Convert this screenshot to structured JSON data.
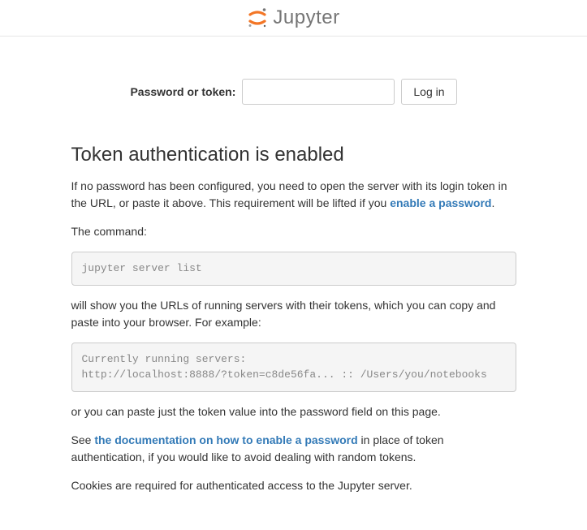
{
  "header": {
    "logo_text": "Jupyter"
  },
  "login": {
    "label": "Password or token:",
    "input_value": "",
    "button_label": "Log in"
  },
  "content": {
    "heading": "Token authentication is enabled",
    "p1_a": "If no password has been configured, you need to open the server with its login token in the URL, or paste it above. This requirement will be lifted if you ",
    "p1_link": "enable a password",
    "p1_b": ".",
    "p2": "The command:",
    "code1": "jupyter server list",
    "p3": "will show you the URLs of running servers with their tokens, which you can copy and paste into your browser. For example:",
    "code2": "Currently running servers:\nhttp://localhost:8888/?token=c8de56fa... :: /Users/you/notebooks",
    "p4": "or you can paste just the token value into the password field on this page.",
    "p5_a": "See ",
    "p5_link": "the documentation on how to enable a password",
    "p5_b": " in place of token authentication, if you would like to avoid dealing with random tokens.",
    "p6": "Cookies are required for authenticated access to the Jupyter server."
  }
}
